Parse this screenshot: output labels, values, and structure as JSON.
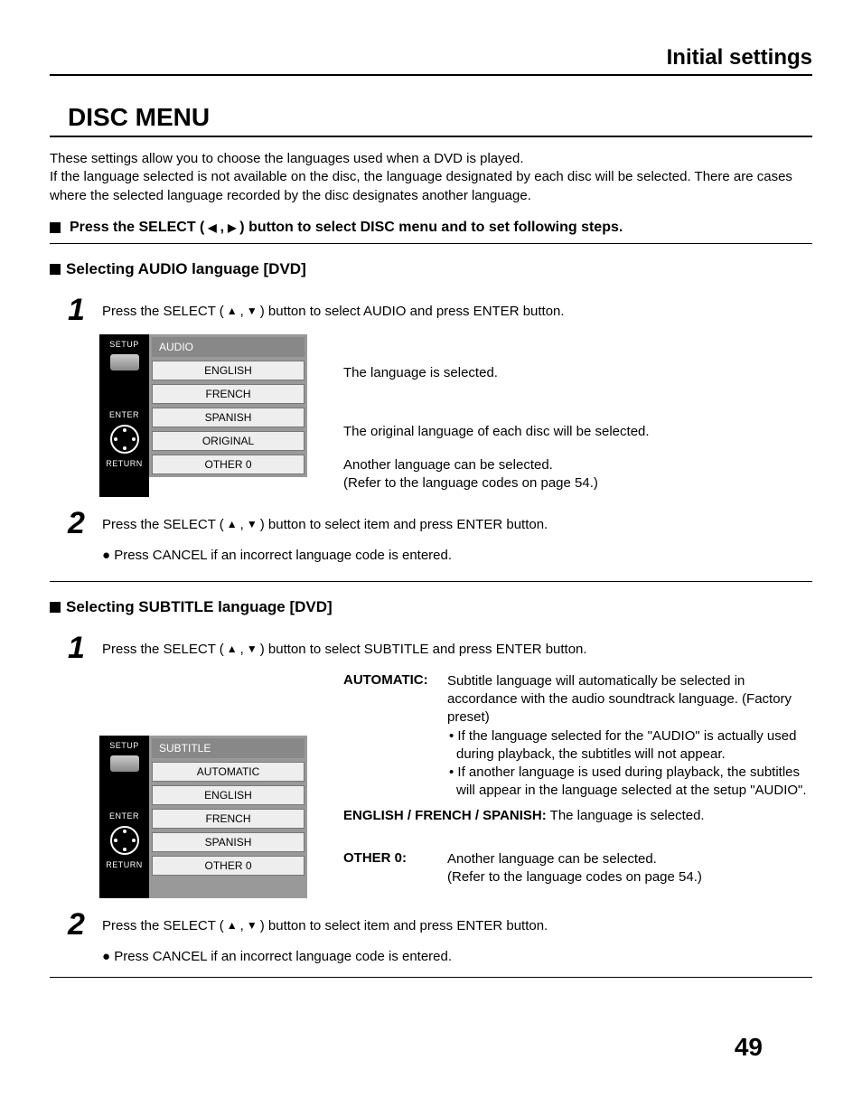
{
  "header": {
    "title": "Initial settings"
  },
  "main_title": "DISC MENU",
  "intro": [
    "These settings allow you to choose the languages used when a DVD is played.",
    "If the language selected is not available on the disc, the language designated by each disc will be selected. There are cases where the selected language recorded by the disc designates another language."
  ],
  "press_instruction": {
    "prefix": "Press the SELECT (",
    "mid": ",",
    "suffix": ") button to select DISC menu and to set following steps."
  },
  "audio_section": {
    "heading": "Selecting AUDIO language [DVD]",
    "step1_num": "1",
    "step1_prefix": "Press the SELECT (",
    "step1_mid": ",",
    "step1_suffix": ") button to select AUDIO and press ENTER button.",
    "remote": {
      "setup": "SETUP",
      "enter": "ENTER",
      "return": "RETURN"
    },
    "menu": {
      "title": "AUDIO",
      "items": [
        "ENGLISH",
        "FRENCH",
        "SPANISH",
        "ORIGINAL",
        "OTHER  0"
      ]
    },
    "annotations": {
      "lang_selected": "The language is selected.",
      "original": "The original language of each disc will be selected.",
      "other_l1": "Another language can be selected.",
      "other_l2": "(Refer to the language codes on page 54.)"
    },
    "step2_num": "2",
    "step2_prefix": "Press the SELECT (",
    "step2_mid": ",",
    "step2_suffix": ") button to select item and press ENTER button.",
    "cancel_note": "● Press CANCEL if an incorrect language code is entered."
  },
  "subtitle_section": {
    "heading": "Selecting SUBTITLE language [DVD]",
    "step1_num": "1",
    "step1_prefix": "Press the SELECT (",
    "step1_mid": ",",
    "step1_suffix": ") button to select SUBTITLE and press ENTER button.",
    "remote": {
      "setup": "SETUP",
      "enter": "ENTER",
      "return": "RETURN"
    },
    "menu": {
      "title": "SUBTITLE",
      "items": [
        "AUTOMATIC",
        "ENGLISH",
        "FRENCH",
        "SPANISH",
        "OTHER  0"
      ]
    },
    "annotations": {
      "auto_label": "AUTOMATIC:",
      "auto_desc": "Subtitle language will automatically be selected in accordance with the audio soundtrack language. (Factory preset)",
      "auto_b1": "• If the language selected for the \"AUDIO\" is actually used during playback, the subtitles will not appear.",
      "auto_b2": "• If another language is used during playback, the subtitles will appear in the language selected at the setup \"AUDIO\".",
      "efs_label": "ENGLISH / FRENCH / SPANISH:",
      "efs_desc": "The language is selected.",
      "other_label": "OTHER 0:",
      "other_l1": "Another language can be selected.",
      "other_l2": "(Refer to the language codes on page 54.)"
    },
    "step2_num": "2",
    "step2_prefix": "Press the SELECT (",
    "step2_mid": ",",
    "step2_suffix": ") button to select item and press ENTER button.",
    "cancel_note": "● Press CANCEL if an incorrect language code is entered."
  },
  "page_number": "49"
}
